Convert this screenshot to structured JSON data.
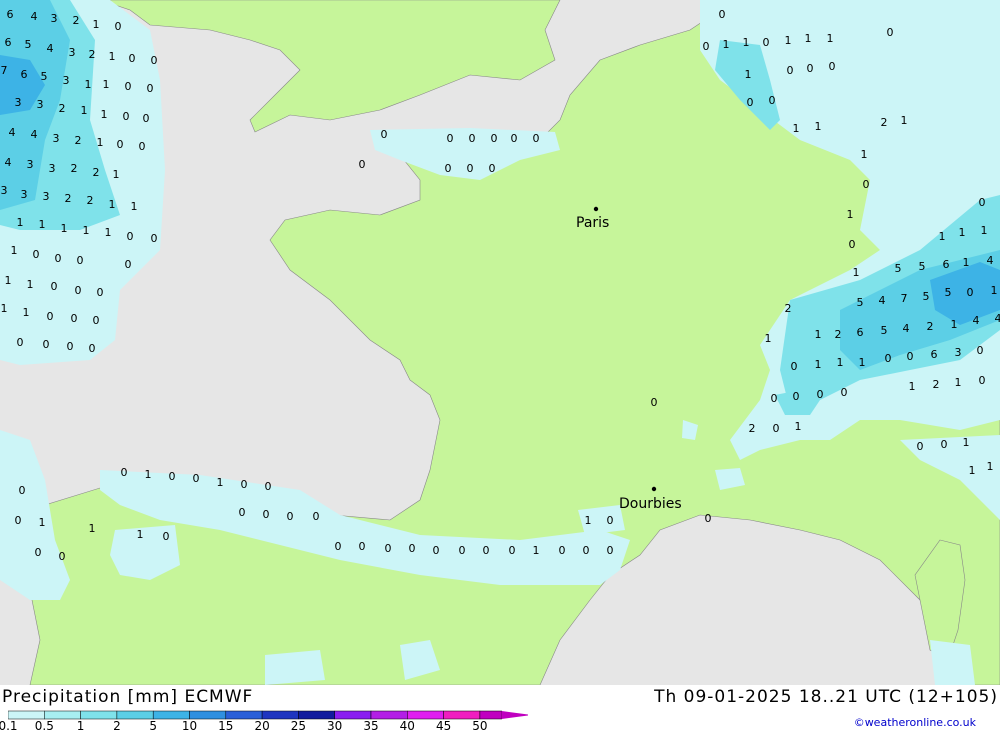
{
  "title": "Precipitation [mm] ECMWF",
  "valid_time": "Th 09-01-2025 18..21 UTC (12+105)",
  "credit": "©weatheronline.co.uk",
  "legend": {
    "ticks": [
      "0.1",
      "0.5",
      "1",
      "2",
      "5",
      "10",
      "15",
      "20",
      "25",
      "30",
      "35",
      "40",
      "45",
      "50"
    ],
    "colors": [
      "#ccf5f7",
      "#a8eef1",
      "#7fe2ea",
      "#5ccfe6",
      "#3db3e6",
      "#2f8fe0",
      "#2a5fd8",
      "#1f35c0",
      "#121c9e",
      "#8a1ef0",
      "#b31ee6",
      "#e01ef0",
      "#f01ec0",
      "#c000c0"
    ]
  },
  "cities": [
    {
      "name": "Paris"
    },
    {
      "name": "Dourbies"
    }
  ],
  "colors": {
    "sea": "#e6e6e6",
    "land": "#c6f59a",
    "precip_light": "#ccf5f7",
    "precip_mid": "#7fe2ea",
    "precip_high": "#3db3e6"
  },
  "grid_values": [
    "6",
    "4",
    "3",
    "2",
    "1",
    "0",
    "6",
    "5",
    "4",
    "3",
    "2",
    "1",
    "0",
    "0",
    "7",
    "6",
    "5",
    "3",
    "1",
    "1",
    "0",
    "0",
    "3",
    "3",
    "2",
    "1",
    "1",
    "0",
    "0",
    "4",
    "4",
    "3",
    "2",
    "1",
    "0",
    "0",
    "4",
    "3",
    "3",
    "2",
    "2",
    "1",
    "3",
    "3",
    "3",
    "2",
    "2",
    "1",
    "1",
    "1",
    "1",
    "1",
    "1",
    "1",
    "0",
    "0",
    "1",
    "0",
    "0",
    "0",
    "0",
    "1",
    "1",
    "0",
    "0",
    "0",
    "1",
    "1",
    "0",
    "0",
    "0",
    "0",
    "0",
    "0",
    "0",
    "0",
    "0",
    "0",
    "0",
    "0",
    "0",
    "0",
    "0",
    "0",
    "0",
    "0",
    "0",
    "1",
    "1",
    "0",
    "1",
    "1",
    "1",
    "0",
    "1",
    "0",
    "0",
    "0",
    "0",
    "0",
    "1",
    "1",
    "2",
    "1",
    "1",
    "0",
    "1",
    "0",
    "0",
    "1",
    "1",
    "1",
    "1",
    "5",
    "5",
    "6",
    "1",
    "4",
    "5",
    "4",
    "7",
    "5",
    "5",
    "0",
    "1",
    "2",
    "1",
    "2",
    "6",
    "5",
    "4",
    "2",
    "1",
    "4",
    "4",
    "1",
    "0",
    "1",
    "1",
    "1",
    "0",
    "0",
    "6",
    "3",
    "0",
    "0",
    "0",
    "0",
    "1",
    "2",
    "1",
    "0",
    "0",
    "0",
    "2",
    "0",
    "1",
    "0",
    "0",
    "1",
    "1",
    "1",
    "0",
    "1",
    "0",
    "0",
    "1",
    "0",
    "0",
    "0",
    "0",
    "0",
    "0",
    "0",
    "0",
    "1",
    "1",
    "1",
    "0",
    "1",
    "0",
    "0",
    "0",
    "0",
    "0",
    "0",
    "0",
    "0",
    "0",
    "0",
    "1",
    "0",
    "0",
    "0",
    "0",
    "0"
  ]
}
